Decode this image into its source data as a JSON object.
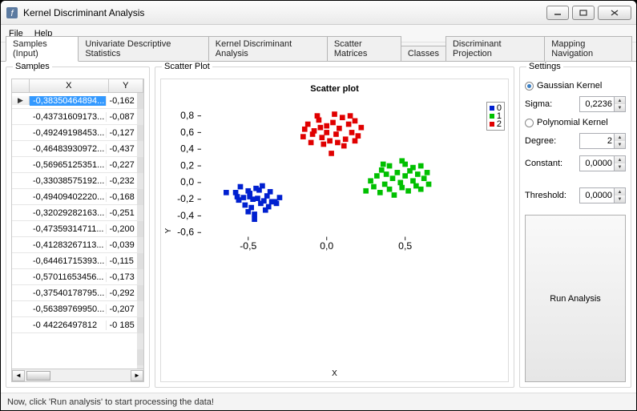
{
  "window": {
    "title": "Kernel Discriminant Analysis"
  },
  "menu": {
    "file": "File",
    "help": "Help"
  },
  "tabs": [
    "Samples (Input)",
    "Univariate Descriptive Statistics",
    "Kernel Discriminant Analysis",
    "Scatter Matrices",
    "Classes",
    "Discriminant Projection",
    "Mapping Navigation"
  ],
  "samples": {
    "group_label": "Samples",
    "headers": {
      "x": "X",
      "y": "Y"
    },
    "rows": [
      {
        "x": "-0,38350464894...",
        "y": "-0,162"
      },
      {
        "x": "-0,43731609173...",
        "y": "-0,087"
      },
      {
        "x": "-0,49249198453...",
        "y": "-0,127"
      },
      {
        "x": "-0,46483930972...",
        "y": "-0,437"
      },
      {
        "x": "-0,56965125351...",
        "y": "-0,227"
      },
      {
        "x": "-0,33038575192...",
        "y": "-0,232"
      },
      {
        "x": "-0,49409402220...",
        "y": "-0,168"
      },
      {
        "x": "-0,32029282163...",
        "y": "-0,251"
      },
      {
        "x": "-0,47359314711...",
        "y": "-0,200"
      },
      {
        "x": "-0,41283267113...",
        "y": "-0,039"
      },
      {
        "x": "-0,64461715393...",
        "y": "-0,115"
      },
      {
        "x": "-0,57011653456...",
        "y": "-0,173"
      },
      {
        "x": "-0,37540178795...",
        "y": "-0,292"
      },
      {
        "x": "-0,56389769950...",
        "y": "-0,207"
      },
      {
        "x": "-0 44226497812",
        "y": "-0 185"
      }
    ]
  },
  "scatter": {
    "group_label": "Scatter Plot",
    "title": "Scatter plot",
    "x_axis_label": "X",
    "y_axis_label": "Y",
    "x_ticks": [
      "-0,5",
      "0,0",
      "0,5"
    ],
    "y_ticks": [
      "-0,6",
      "-0,4",
      "-0,2",
      "0,0",
      "0,2",
      "0,4",
      "0,6",
      "0,8"
    ],
    "legend": [
      {
        "label": "0",
        "color": "#0020d0"
      },
      {
        "label": "1",
        "color": "#00c000"
      },
      {
        "label": "2",
        "color": "#e00000"
      }
    ]
  },
  "settings": {
    "group_label": "Settings",
    "gaussian_label": "Gaussian Kernel",
    "sigma_label": "Sigma:",
    "sigma_value": "0,2236",
    "polynomial_label": "Polynomial Kernel",
    "degree_label": "Degree:",
    "degree_value": "2",
    "constant_label": "Constant:",
    "constant_value": "0,0000",
    "threshold_label": "Threshold:",
    "threshold_value": "0,0000",
    "run_label": "Run Analysis"
  },
  "status": "Now, click 'Run analysis' to start processing the data!",
  "chart_data": {
    "type": "scatter",
    "title": "Scatter plot",
    "xlabel": "X",
    "ylabel": "Y",
    "xlim": [
      -0.8,
      0.9
    ],
    "ylim": [
      -0.65,
      0.95
    ],
    "series": [
      {
        "name": "0",
        "color": "#0020d0",
        "points": [
          [
            -0.58,
            -0.12
          ],
          [
            -0.56,
            -0.21
          ],
          [
            -0.55,
            -0.05
          ],
          [
            -0.53,
            -0.18
          ],
          [
            -0.52,
            -0.27
          ],
          [
            -0.5,
            -0.1
          ],
          [
            -0.49,
            -0.13
          ],
          [
            -0.49,
            -0.17
          ],
          [
            -0.48,
            -0.3
          ],
          [
            -0.47,
            -0.2
          ],
          [
            -0.46,
            -0.44
          ],
          [
            -0.45,
            -0.07
          ],
          [
            -0.44,
            -0.19
          ],
          [
            -0.43,
            -0.09
          ],
          [
            -0.42,
            -0.25
          ],
          [
            -0.41,
            -0.04
          ],
          [
            -0.4,
            -0.22
          ],
          [
            -0.39,
            -0.33
          ],
          [
            -0.38,
            -0.16
          ],
          [
            -0.37,
            -0.29
          ],
          [
            -0.36,
            -0.11
          ],
          [
            -0.35,
            -0.23
          ],
          [
            -0.33,
            -0.23
          ],
          [
            -0.32,
            -0.25
          ],
          [
            -0.3,
            -0.18
          ],
          [
            -0.64,
            -0.12
          ],
          [
            -0.57,
            -0.17
          ],
          [
            -0.56,
            -0.21
          ],
          [
            -0.5,
            -0.35
          ],
          [
            -0.46,
            -0.38
          ]
        ]
      },
      {
        "name": "1",
        "color": "#00c000",
        "points": [
          [
            0.25,
            -0.1
          ],
          [
            0.28,
            0.02
          ],
          [
            0.3,
            -0.05
          ],
          [
            0.32,
            0.08
          ],
          [
            0.34,
            -0.12
          ],
          [
            0.35,
            0.15
          ],
          [
            0.37,
            -0.02
          ],
          [
            0.38,
            0.1
          ],
          [
            0.4,
            -0.08
          ],
          [
            0.42,
            0.05
          ],
          [
            0.43,
            -0.15
          ],
          [
            0.45,
            0.12
          ],
          [
            0.47,
            0.0
          ],
          [
            0.48,
            -0.06
          ],
          [
            0.5,
            0.08
          ],
          [
            0.52,
            -0.1
          ],
          [
            0.53,
            0.14
          ],
          [
            0.55,
            0.02
          ],
          [
            0.57,
            -0.04
          ],
          [
            0.58,
            0.1
          ],
          [
            0.6,
            -0.08
          ],
          [
            0.62,
            0.05
          ],
          [
            0.64,
            0.12
          ],
          [
            0.65,
            -0.02
          ],
          [
            0.4,
            0.2
          ],
          [
            0.5,
            0.22
          ],
          [
            0.55,
            0.18
          ],
          [
            0.6,
            0.2
          ],
          [
            0.48,
            0.26
          ],
          [
            0.36,
            0.22
          ]
        ]
      },
      {
        "name": "2",
        "color": "#e00000",
        "points": [
          [
            -0.15,
            0.55
          ],
          [
            -0.12,
            0.7
          ],
          [
            -0.1,
            0.48
          ],
          [
            -0.08,
            0.62
          ],
          [
            -0.05,
            0.75
          ],
          [
            -0.03,
            0.54
          ],
          [
            0.0,
            0.68
          ],
          [
            0.02,
            0.5
          ],
          [
            0.04,
            0.72
          ],
          [
            0.06,
            0.58
          ],
          [
            0.08,
            0.65
          ],
          [
            0.1,
            0.78
          ],
          [
            0.12,
            0.52
          ],
          [
            0.14,
            0.7
          ],
          [
            0.16,
            0.6
          ],
          [
            0.18,
            0.74
          ],
          [
            -0.14,
            0.64
          ],
          [
            -0.06,
            0.8
          ],
          [
            0.03,
            0.35
          ],
          [
            0.2,
            0.56
          ],
          [
            0.22,
            0.66
          ],
          [
            0.05,
            0.82
          ],
          [
            -0.02,
            0.46
          ],
          [
            0.11,
            0.44
          ],
          [
            0.15,
            0.8
          ],
          [
            0.07,
            0.48
          ],
          [
            -0.09,
            0.58
          ],
          [
            -0.04,
            0.66
          ],
          [
            0.18,
            0.5
          ],
          [
            0.0,
            0.6
          ]
        ]
      }
    ]
  }
}
